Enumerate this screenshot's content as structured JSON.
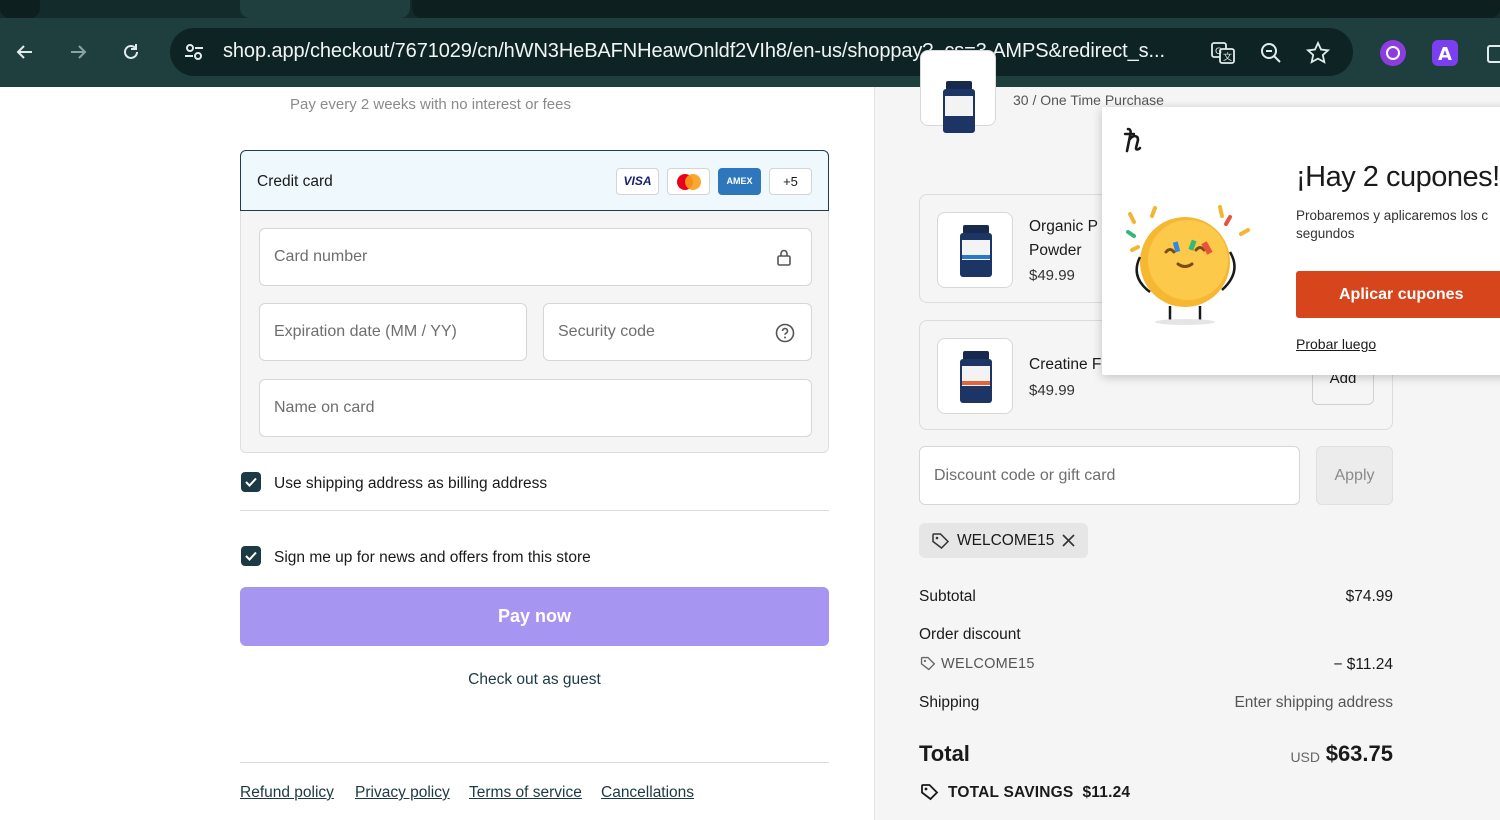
{
  "browser": {
    "url": "shop.app/checkout/7671029/cn/hWN3HeBAFNHeawOnldf2VIh8/en-us/shoppay?_cs=3.AMPS&redirect_s...",
    "icons": [
      "back-icon",
      "forward-icon",
      "reload-icon",
      "site-settings-icon",
      "translate-icon",
      "zoom-icon",
      "bookmark-star-icon",
      "extension-icon",
      "profile-icon",
      "puzzle-icon"
    ]
  },
  "checkout": {
    "pay_every_text": "Pay every 2 weeks with no interest or fees",
    "credit_card": {
      "title": "Credit card",
      "logos": [
        "VISA",
        "Mastercard",
        "AMEX",
        "+5"
      ],
      "card_number_placeholder": "Card number",
      "expiration_placeholder": "Expiration date (MM / YY)",
      "security_placeholder": "Security code",
      "name_placeholder": "Name on card"
    },
    "billing_checkbox_label": "Use shipping address as billing address",
    "news_checkbox_label": "Sign me up for news and offers from this store",
    "pay_button": "Pay now",
    "guest_link": "Check out as guest",
    "footer_links": [
      "Refund policy",
      "Privacy policy",
      "Terms of service",
      "Cancellations"
    ]
  },
  "summary": {
    "first_item_variant": "30 / One Time Purchase",
    "upsells": [
      {
        "name_line1": "Organic P",
        "name_line2": "Powder",
        "price": "$49.99"
      },
      {
        "name_line1": "Creatine F",
        "price": "$49.99",
        "button": "Add"
      }
    ],
    "discount_placeholder": "Discount code or gift card",
    "apply_button": "Apply",
    "applied_code": "WELCOME15",
    "subtotal_label": "Subtotal",
    "subtotal_value": "$74.99",
    "order_discount_label": "Order discount",
    "order_discount_code": "WELCOME15",
    "order_discount_value": "− $11.24",
    "shipping_label": "Shipping",
    "shipping_value": "Enter shipping address",
    "total_label": "Total",
    "total_currency": "USD",
    "total_value": "$63.75",
    "total_savings": "TOTAL SAVINGS  $11.24"
  },
  "coupon_popup": {
    "title": "¡Hay 2 cupones!",
    "subtitle": "Probaremos y aplicaremos los c segundos",
    "apply_button": "Aplicar cupones",
    "later_link": "Probar luego"
  },
  "colors": {
    "chrome_bg": "#1f3e3e",
    "pay_button": "#a695f1",
    "checkbox": "#1c3a44",
    "popup_accent": "#d7451c"
  }
}
